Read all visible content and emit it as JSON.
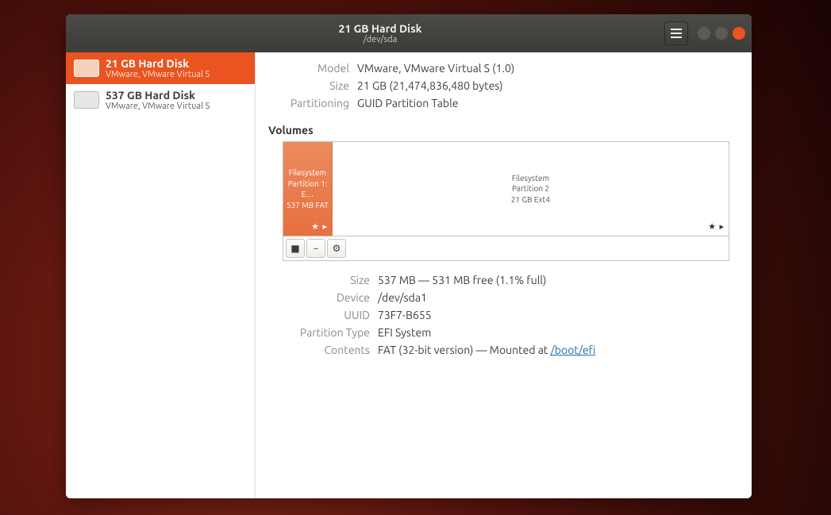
{
  "titlebar": {
    "title": "21 GB Hard Disk",
    "subtitle": "/dev/sda"
  },
  "sidebar": {
    "items": [
      {
        "title": "21 GB Hard Disk",
        "sub": "VMware, VMware Virtual S",
        "selected": true
      },
      {
        "title": "537 GB Hard Disk",
        "sub": "VMware, VMware Virtual S",
        "selected": false
      }
    ]
  },
  "disk": {
    "model_label": "Model",
    "model_value": "VMware, VMware Virtual S (1.0)",
    "size_label": "Size",
    "size_value": "21 GB (21,474,836,480 bytes)",
    "part_label": "Partitioning",
    "part_value": "GUID Partition Table"
  },
  "volumes": {
    "header": "Volumes",
    "parts": [
      {
        "l1": "Filesystem",
        "l2": "Partition 1: E…",
        "l3": "537 MB FAT"
      },
      {
        "l1": "Filesystem",
        "l2": "Partition 2",
        "l3": "21 GB Ext4"
      }
    ]
  },
  "detail": {
    "size_label": "Size",
    "size_value": "537 MB — 531 MB free (1.1% full)",
    "dev_label": "Device",
    "dev_value": "/dev/sda1",
    "uuid_label": "UUID",
    "uuid_value": "73F7-B655",
    "pt_label": "Partition Type",
    "pt_value": "EFI System",
    "ct_label": "Contents",
    "ct_prefix": "FAT (32-bit version) — Mounted at ",
    "ct_link": "/boot/efi"
  }
}
